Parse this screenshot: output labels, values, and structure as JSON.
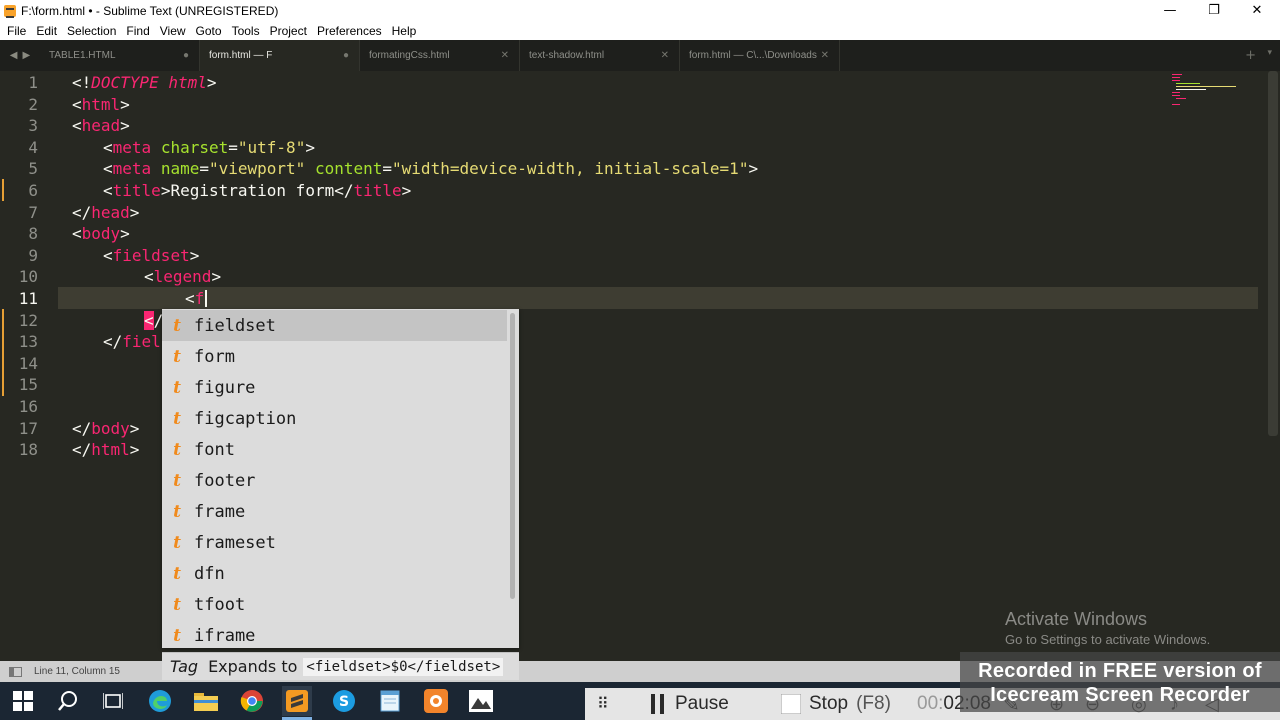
{
  "window": {
    "title": "F:\\form.html • - Sublime Text (UNREGISTERED)",
    "controls": {
      "minimize": "—",
      "maximize": "❐",
      "close": "✕"
    }
  },
  "menu": [
    "File",
    "Edit",
    "Selection",
    "Find",
    "View",
    "Goto",
    "Tools",
    "Project",
    "Preferences",
    "Help"
  ],
  "tabs": [
    {
      "label": "TABLE1.HTML",
      "close": "●",
      "active": false
    },
    {
      "label": "form.html — F",
      "close": "●",
      "active": true
    },
    {
      "label": "formatingCss.html",
      "close": "✕",
      "active": false
    },
    {
      "label": "text-shadow.html",
      "close": "✕",
      "active": false
    },
    {
      "label": "form.html — C\\...\\Downloads",
      "close": "✕",
      "active": false
    }
  ],
  "tabbar": {
    "add": "+",
    "more": "▾"
  },
  "editor": {
    "current_line": 11,
    "line_numbers": [
      "1",
      "2",
      "3",
      "4",
      "5",
      "6",
      "7",
      "8",
      "9",
      "10",
      "11",
      "12",
      "13",
      "14",
      "15",
      "16",
      "17",
      "18"
    ],
    "lines": {
      "l1": {
        "open": "<!",
        "doctype": "DOCTYPE html",
        "close": ">"
      },
      "l2": {
        "open": "<",
        "tag": "html",
        "close": ">"
      },
      "l3": {
        "open": "<",
        "tag": "head",
        "close": ">"
      },
      "l4": {
        "open": "<",
        "tag": "meta",
        "attr": "charset",
        "eq": "=",
        "val": "\"utf-8\"",
        "close": ">"
      },
      "l5": {
        "open": "<",
        "tag": "meta",
        "attr1": "name",
        "eq1": "=",
        "val1": "\"viewport\"",
        "attr2": "content",
        "eq2": "=",
        "val2": "\"width=device-width, initial-scale=1\"",
        "close": ">"
      },
      "l6": {
        "open": "<",
        "tag": "title",
        "close": ">",
        "text": "Registration form",
        "open2": "</",
        "tag2": "title",
        "close2": ">"
      },
      "l7": {
        "open": "</",
        "tag": "head",
        "close": ">"
      },
      "l8": {
        "open": "<",
        "tag": "body",
        "close": ">"
      },
      "l9": {
        "open": "<",
        "tag": "fieldset",
        "close": ">"
      },
      "l10": {
        "open": "<",
        "tag": "legend",
        "close": ">"
      },
      "l11": {
        "open": "<",
        "tag": "f"
      },
      "l12": {
        "err": "<",
        "rest": "/"
      },
      "l13": {
        "open": "</",
        "tag": "fiel"
      },
      "l17": {
        "open": "</",
        "tag": "body",
        "close": ">"
      },
      "l18": {
        "open": "</",
        "tag": "html",
        "close": ">"
      }
    }
  },
  "autocomplete": {
    "kind": "t",
    "items": [
      "fieldset",
      "form",
      "figure",
      "figcaption",
      "font",
      "footer",
      "frame",
      "frameset",
      "dfn",
      "tfoot",
      "iframe"
    ],
    "selected": "fieldset",
    "annotation": {
      "tag": "Tag",
      "expands": "Expands to",
      "code": "<fieldset>$0</fieldset>"
    }
  },
  "status": {
    "position": "Line 11, Column 15"
  },
  "activation": {
    "title": "Activate Windows",
    "subtitle": "Go to Settings to activate Windows."
  },
  "taskbar": [
    "windows-start",
    "search",
    "task-view",
    "edge",
    "file-explorer",
    "chrome",
    "sublime-text",
    "skype",
    "notepad",
    "icecream",
    "photos"
  ],
  "recorder": {
    "pause": "Pause",
    "stop": "Stop",
    "stop_key": "(F8)",
    "time_dim": "00:",
    "time": "02:08",
    "watermark_line1": "Recorded in FREE version of",
    "watermark_line2": "Icecream   Screen   Recorder"
  },
  "colors": {
    "editor_bg": "#272822",
    "tag": "#f92672",
    "attribute": "#a6e22e",
    "string": "#e6db74",
    "autocomplete_kind": "#f08a1c",
    "taskbar": "#1b2633"
  }
}
